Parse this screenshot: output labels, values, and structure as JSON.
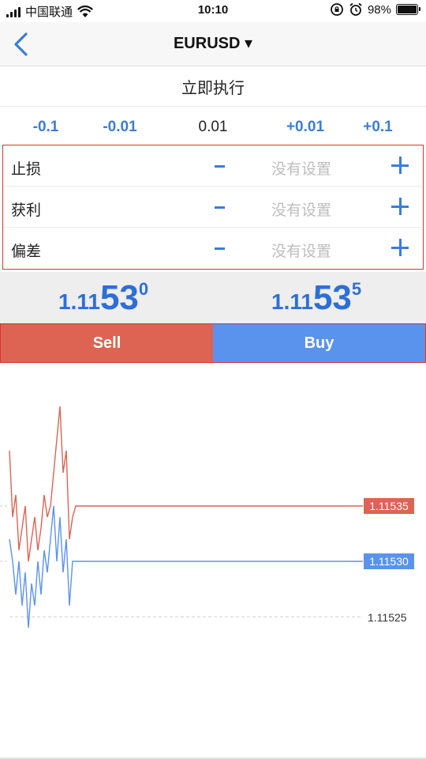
{
  "status_bar": {
    "carrier": "中国联通",
    "time": "10:10",
    "battery": "98%",
    "battery_level": 0.98
  },
  "nav": {
    "title": "EURUSD ▾"
  },
  "execution_mode": "立即执行",
  "volume": {
    "minus_large": "-0.1",
    "minus_small": "-0.01",
    "value": "0.01",
    "plus_small": "+0.01",
    "plus_large": "+0.1"
  },
  "params": [
    {
      "label": "止损",
      "value": "没有设置"
    },
    {
      "label": "获利",
      "value": "没有设置"
    },
    {
      "label": "偏差",
      "value": "没有设置"
    }
  ],
  "prices": {
    "sell": {
      "small": "1.11",
      "big": "53",
      "sup": "0"
    },
    "buy": {
      "small": "1.11",
      "big": "53",
      "sup": "5"
    }
  },
  "trade": {
    "sell_label": "Sell",
    "buy_label": "Buy"
  },
  "colors": {
    "accent": "#3b7dd8",
    "sell": "#dd6453",
    "buy": "#5a93ee",
    "highlight": "#e03131"
  },
  "chart_data": {
    "type": "line",
    "y_ticks": [
      "1.11525"
    ],
    "ylim": [
      1.11522,
      1.11547
    ],
    "ask_label": "1.11535",
    "bid_label": "1.11530",
    "ask_value": 1.11535,
    "bid_value": 1.1153,
    "grid_level": 1.11525,
    "series": [
      {
        "values": [
          1.1154,
          1.11534,
          1.11536,
          1.11531,
          1.11533,
          1.11535,
          1.1153,
          1.11532,
          1.11534,
          1.11531,
          1.11533,
          1.11536,
          1.11534,
          1.11535,
          1.11538,
          1.11541,
          1.11544,
          1.11538,
          1.1154,
          1.11532,
          1.11534,
          1.11535,
          1.11535,
          1.11535
        ]
      },
      {
        "values": [
          1.11532,
          1.1153,
          1.11527,
          1.1153,
          1.11526,
          1.11529,
          1.11524,
          1.11528,
          1.11526,
          1.1153,
          1.11527,
          1.11531,
          1.11529,
          1.11532,
          1.11535,
          1.1153,
          1.11534,
          1.11529,
          1.11532,
          1.11526,
          1.1153,
          1.1153,
          1.1153,
          1.1153
        ]
      }
    ]
  }
}
